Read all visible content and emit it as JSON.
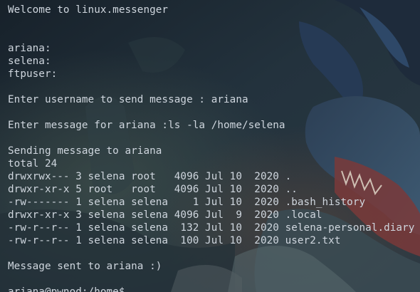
{
  "terminal": {
    "lines": [
      "Welcome to linux.messenger",
      "",
      "",
      "ariana:",
      "selena:",
      "ftpuser:",
      "",
      "Enter username to send message : ariana",
      "",
      "Enter message for ariana :ls -la /home/selena",
      "",
      "Sending message to ariana",
      "total 24",
      "drwxrwx--- 3 selena root   4096 Jul 10  2020 .",
      "drwxr-xr-x 5 root   root   4096 Jul 10  2020 ..",
      "-rw------- 1 selena selena    1 Jul 10  2020 .bash_history",
      "drwxr-xr-x 3 selena selena 4096 Jul  9  2020 .local",
      "-rw-r--r-- 1 selena selena  132 Jul 10  2020 selena-personal.diary",
      "-rw-r--r-- 1 selena selena  100 Jul 10  2020 user2.txt",
      "",
      "Message sent to ariana :)",
      "",
      "ariana@pwnod:/home$"
    ]
  },
  "colors": {
    "text": "#cfd6de",
    "background": "#1f2a33"
  },
  "wallpaper": {
    "icon": "dragon-wallpaper-icon"
  }
}
